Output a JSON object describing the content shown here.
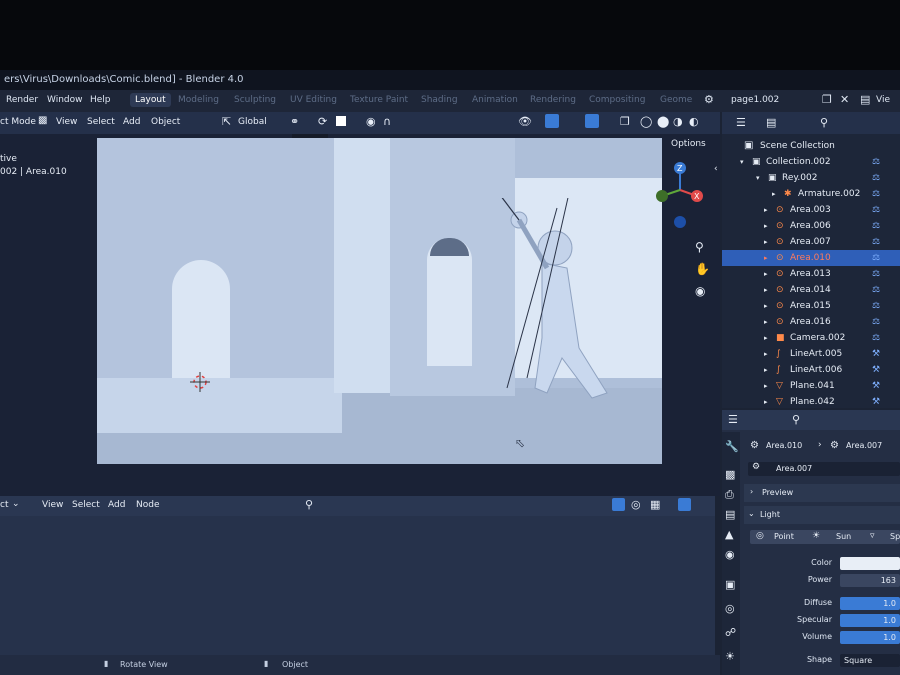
{
  "window": {
    "title": "ers\\Virus\\Downloads\\Comic.blend] - Blender 4.0"
  },
  "menu": {
    "render": "Render",
    "window": "Window",
    "help": "Help"
  },
  "workspaces": [
    "Layout",
    "Modeling",
    "Sculpting",
    "UV Editing",
    "Texture Paint",
    "Shading",
    "Animation",
    "Rendering",
    "Compositing",
    "Geome"
  ],
  "scene_name": "page1.002",
  "view_layer": "Vie",
  "toolbar": {
    "mode": "ct Mode",
    "view": "View",
    "select": "Select",
    "add": "Add",
    "object": "Object",
    "orientation": "Global",
    "options": "Options"
  },
  "viewport_info": {
    "line1": "tive",
    "line2": "002 | Area.010"
  },
  "outliner": {
    "root": "Scene Collection",
    "items": [
      {
        "label": "Collection.002",
        "icon": "collection-icon",
        "selected": false
      },
      {
        "label": "Rey.002",
        "icon": "collection-icon",
        "selected": false
      },
      {
        "label": "Armature.002",
        "icon": "armature-icon",
        "selected": false
      },
      {
        "label": "Area.003",
        "icon": "light-icon",
        "selected": false
      },
      {
        "label": "Area.006",
        "icon": "light-icon",
        "selected": false
      },
      {
        "label": "Area.007",
        "icon": "light-icon",
        "selected": false
      },
      {
        "label": "Area.010",
        "icon": "light-icon",
        "selected": true
      },
      {
        "label": "Area.013",
        "icon": "light-icon",
        "selected": false
      },
      {
        "label": "Area.014",
        "icon": "light-icon",
        "selected": false
      },
      {
        "label": "Area.015",
        "icon": "light-icon",
        "selected": false
      },
      {
        "label": "Area.016",
        "icon": "light-icon",
        "selected": false
      },
      {
        "label": "Camera.002",
        "icon": "camera-icon",
        "selected": false
      },
      {
        "label": "LineArt.005",
        "icon": "lineart-icon",
        "selected": false
      },
      {
        "label": "LineArt.006",
        "icon": "lineart-icon",
        "selected": false
      },
      {
        "label": "Plane.041",
        "icon": "mesh-icon",
        "selected": false
      },
      {
        "label": "Plane.042",
        "icon": "mesh-icon",
        "selected": false
      }
    ]
  },
  "properties": {
    "breadcrumb_object": "Area.010",
    "breadcrumb_data": "Area.007",
    "datablock": "Area.007",
    "preview_label": "Preview",
    "light_label": "Light",
    "light_types": [
      "Point",
      "Sun",
      "Sp"
    ],
    "color_label": "Color",
    "power_label": "Power",
    "power_value": "163",
    "diffuse_label": "Diffuse",
    "diffuse_value": "1.0",
    "specular_label": "Specular",
    "specular_value": "1.0",
    "volume_label": "Volume",
    "volume_value": "1.0",
    "shape_label": "Shape",
    "shape_value": "Square"
  },
  "node_editor": {
    "editor": "ct",
    "view": "View",
    "select": "Select",
    "add": "Add",
    "node": "Node"
  },
  "statusbar": {
    "rotate": "Rotate View",
    "object": "Object"
  }
}
